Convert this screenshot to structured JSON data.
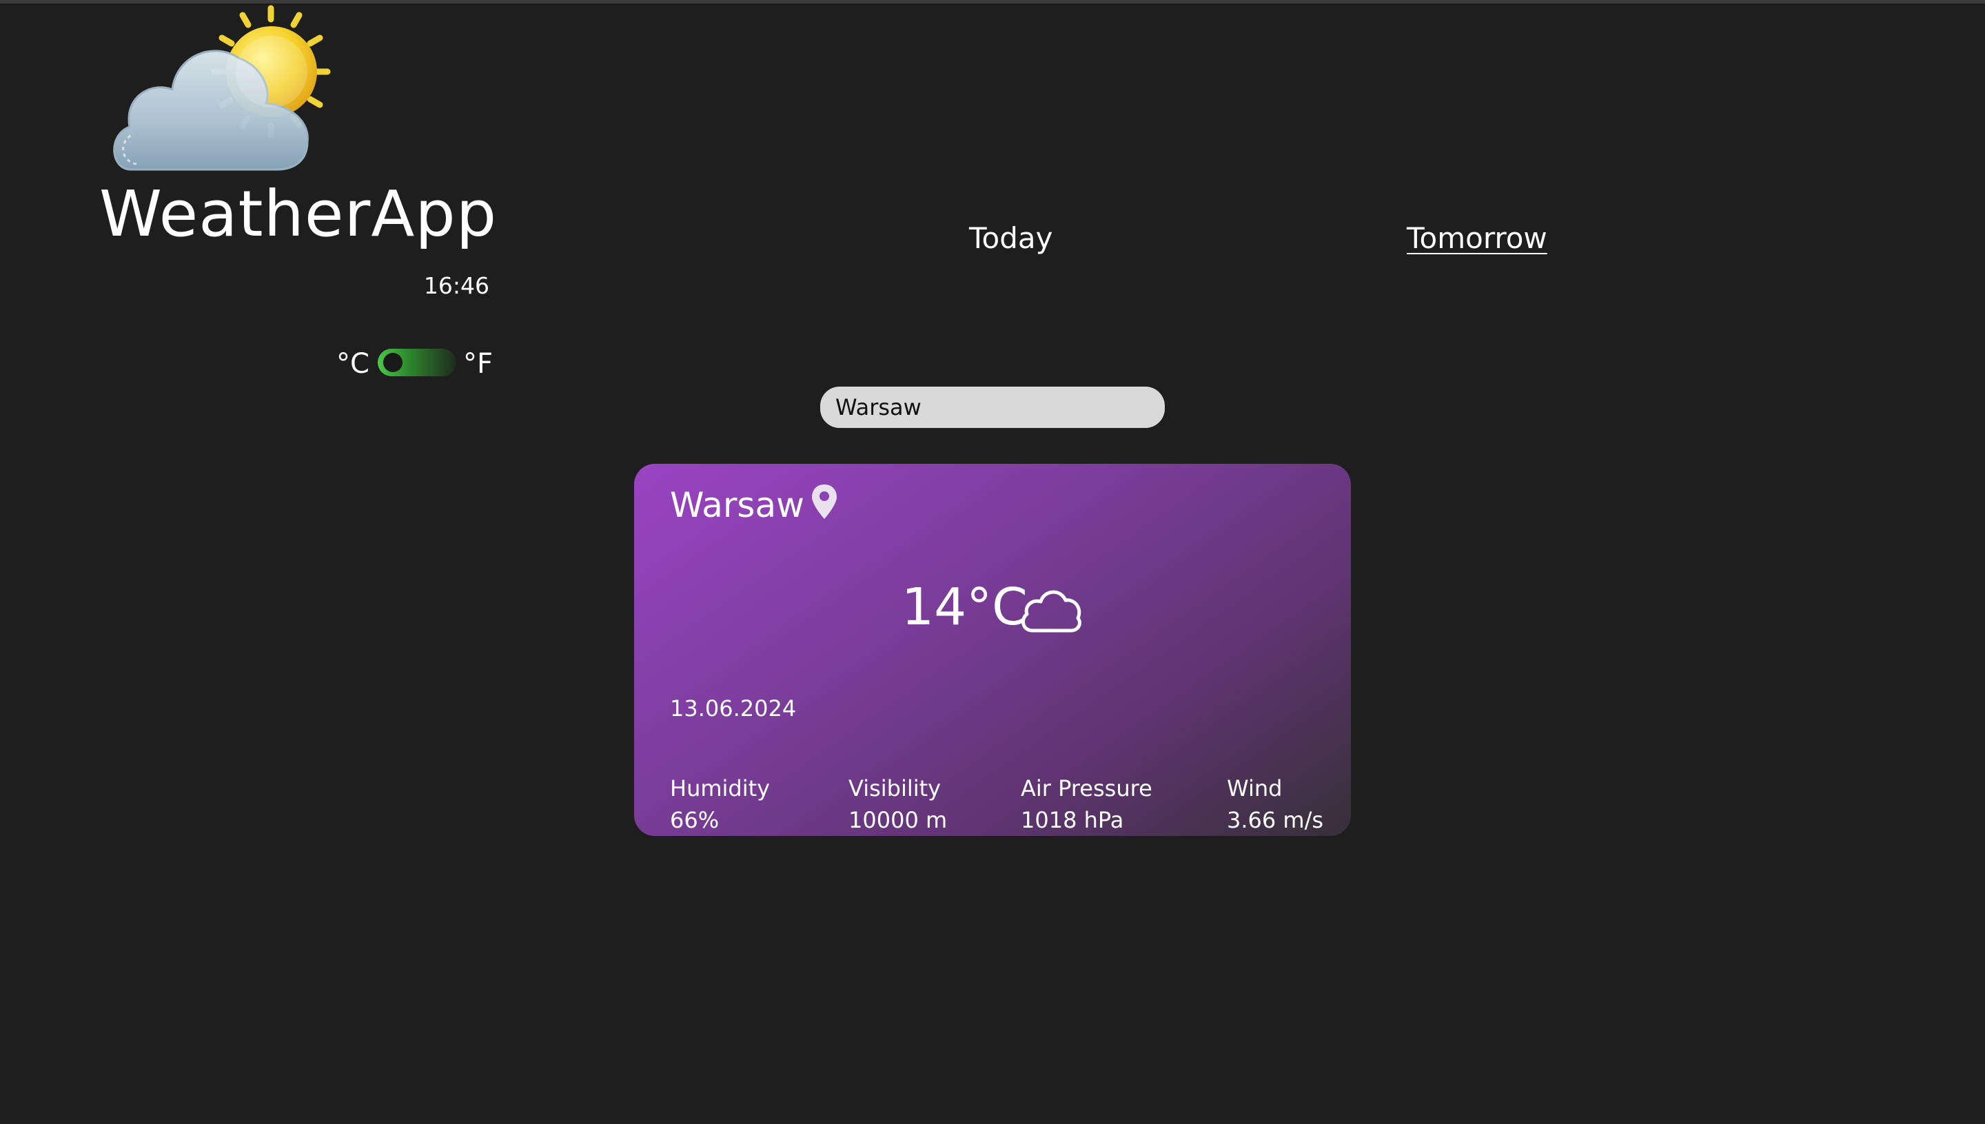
{
  "app": {
    "title": "WeatherApp",
    "time": "16:46"
  },
  "units": {
    "celsius_label": "°C",
    "fahrenheit_label": "°F",
    "selected": "°C"
  },
  "tabs": [
    {
      "label": "Today",
      "active": false
    },
    {
      "label": "Tomorrow",
      "active": true
    }
  ],
  "search": {
    "value": "Warsaw",
    "placeholder": ""
  },
  "card": {
    "city": "Warsaw",
    "temperature": "14°C",
    "date": "13.06.2024",
    "condition_icon": "cloud-icon",
    "stats": [
      {
        "label": "Humidity",
        "value": "66%"
      },
      {
        "label": "Visibility",
        "value": "10000 m"
      },
      {
        "label": "Air Pressure",
        "value": "1018 hPa"
      },
      {
        "label": "Wind",
        "value": "3.66 m/s"
      }
    ]
  },
  "colors": {
    "background": "#1e1e1e",
    "card_gradient_start": "#9a44c3",
    "card_gradient_end": "#363038",
    "toggle_accent": "#4cc94a",
    "search_bg": "#d9d9d9",
    "sun": "#f3c21b",
    "cloud": "#a7c3d6"
  }
}
